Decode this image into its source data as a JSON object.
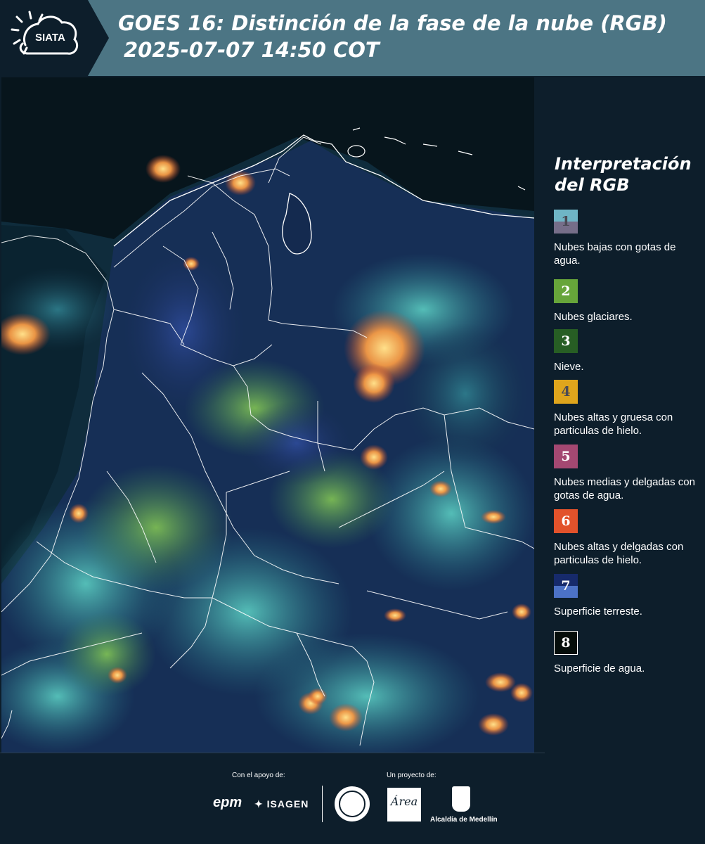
{
  "header": {
    "logo_text": "SIATA",
    "title": "GOES 16: Distinción de la fase de la nube (RGB)",
    "timestamp": "2025-07-07 14:50 COT"
  },
  "legend": {
    "title_line1": "Interpretación",
    "title_line2": "del RGB",
    "items": [
      {
        "number": "1",
        "label": "Nubes bajas con gotas de agua.",
        "color_top": "#6fb5c6",
        "color_bottom": "#766e89"
      },
      {
        "number": "2",
        "label": "Nubes glaciares.",
        "color": "#67a53a"
      },
      {
        "number": "3",
        "label": "Nieve.",
        "color": "#275e24"
      },
      {
        "number": "4",
        "label": "Nubes altas y gruesa con particulas de hielo.",
        "color": "#dfa51c"
      },
      {
        "number": "5",
        "label": "Nubes medias y delgadas con gotas de agua.",
        "color": "#a44872"
      },
      {
        "number": "6",
        "label": "Nubes altas y delgadas con particulas de hielo.",
        "color": "#e2522b"
      },
      {
        "number": "7",
        "label": "Superficie terreste.",
        "color_top": "#162a6b",
        "color_bottom": "#4c72c6"
      },
      {
        "number": "8",
        "label": "Superficie de agua.",
        "color": "#050d0a"
      }
    ]
  },
  "footer": {
    "support_label": "Con el apoyo de:",
    "project_label": "Un proyecto de:",
    "sponsor_epm": "epm",
    "sponsor_isagen": "ISAGEN",
    "area_logo_text": "Área",
    "alcaldia_label": "Alcaldía de Medellín"
  }
}
